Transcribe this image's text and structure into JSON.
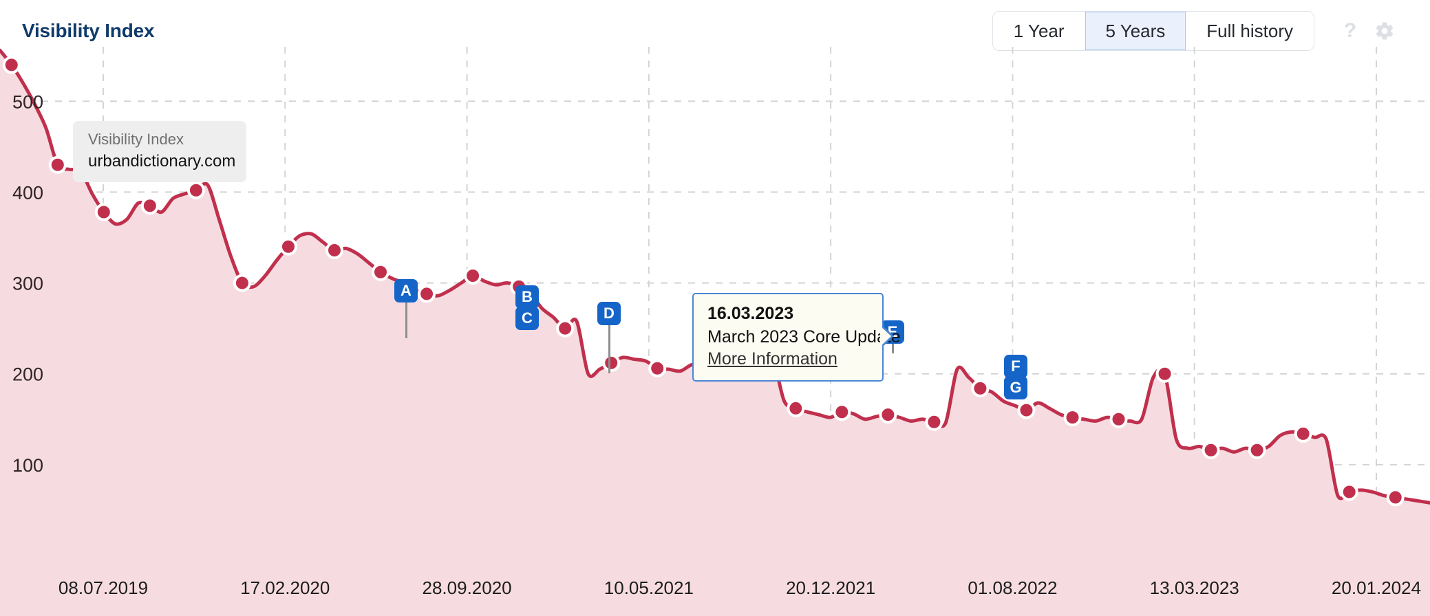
{
  "header": {
    "title": "Visibility Index",
    "range_buttons": [
      {
        "label": "1 Year",
        "active": false
      },
      {
        "label": "5 Years",
        "active": true
      },
      {
        "label": "Full history",
        "active": false
      }
    ],
    "help_icon": "question-mark-icon",
    "settings_icon": "gear-icon"
  },
  "series_legend": {
    "title": "Visibility Index",
    "domain": "urbandictionary.com"
  },
  "tooltip": {
    "date": "16.03.2023",
    "update_name": "March 2023 Core Update",
    "link_label": "More Information"
  },
  "event_markers": [
    {
      "letters": [
        "A"
      ],
      "x": 590,
      "label_top": 338,
      "stem_bottom": 424
    },
    {
      "letters": [
        "B",
        "C"
      ],
      "x": 766,
      "label_top": 347,
      "stem_bottom": 410
    },
    {
      "letters": [
        "D"
      ],
      "x": 885,
      "label_top": 371,
      "stem_bottom": 475
    },
    {
      "letters": [
        "E"
      ],
      "x": 1297,
      "label_top": 398,
      "stem_bottom": 446
    },
    {
      "letters": [
        "F",
        "G"
      ],
      "x": 1476,
      "label_top": 448,
      "stem_bottom": 505
    }
  ],
  "colors": {
    "accent_line": "#c0304d",
    "area_fill": "#f6dce1",
    "marker_blue": "#1565c9",
    "grid": "#d4d4d4",
    "title": "#103a6b",
    "active_tab_bg": "#eaf1fd",
    "active_tab_border": "#a9c7f2"
  },
  "chart_data": {
    "type": "area",
    "title": "Visibility Index",
    "xlabel": "",
    "ylabel": "Visibility Index",
    "ylim": [
      0,
      560
    ],
    "grid": true,
    "legend_position": "top-left-inside",
    "yticks": [
      100,
      200,
      300,
      400,
      500
    ],
    "xticks": [
      "08.07.2019",
      "17.02.2020",
      "28.09.2020",
      "10.05.2021",
      "20.12.2021",
      "01.08.2022",
      "13.03.2023",
      "20.01.2024"
    ],
    "series": [
      {
        "name": "urbandictionary.com",
        "color": "#c0304d",
        "values": [
          556,
          540,
          520,
          497,
          470,
          430,
          425,
          423,
          398,
          378,
          365,
          370,
          388,
          385,
          378,
          393,
          398,
          402,
          408,
          370,
          330,
          300,
          296,
          308,
          325,
          340,
          352,
          354,
          345,
          336,
          338,
          332,
          322,
          312,
          305,
          300,
          292,
          288,
          286,
          292,
          300,
          308,
          302,
          298,
          300,
          296,
          288,
          272,
          262,
          250,
          258,
          200,
          205,
          212,
          218,
          216,
          214,
          206,
          205,
          203,
          210,
          208,
          206,
          205,
          200,
          212,
          222,
          218,
          170,
          162,
          158,
          155,
          152,
          158,
          156,
          150,
          153,
          155,
          152,
          148,
          150,
          147,
          146,
          205,
          196,
          184,
          180,
          170,
          165,
          160,
          168,
          162,
          155,
          152,
          150,
          148,
          152,
          150,
          148,
          150,
          196,
          200,
          128,
          118,
          120,
          116,
          118,
          114,
          118,
          116,
          120,
          132,
          136,
          134,
          130,
          128,
          66,
          70,
          72,
          70,
          66,
          64,
          62,
          60,
          58
        ]
      }
    ],
    "markers": [
      {
        "letter": "A",
        "date_index": 51
      },
      {
        "letter": "B",
        "date_index": 68
      },
      {
        "letter": "C",
        "date_index": 68
      },
      {
        "letter": "D",
        "date_index": 83
      },
      {
        "letter": "E",
        "date_index": 102
      },
      {
        "letter": "F",
        "date_index": 118
      },
      {
        "letter": "G",
        "date_index": 118
      }
    ]
  }
}
